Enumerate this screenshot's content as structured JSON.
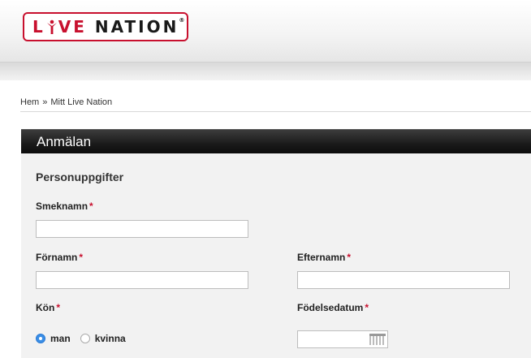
{
  "brand": {
    "logo_left": "L",
    "logo_mid": "VE",
    "logo_right": "NATION",
    "logo_full": "LIVE NATION",
    "accent_color": "#c8102e"
  },
  "breadcrumb": {
    "home": "Hem",
    "separator": "»",
    "current": "Mitt Live Nation"
  },
  "panel": {
    "title": "Anmälan",
    "section_title": "Personuppgifter"
  },
  "form": {
    "required_mark": "*",
    "nickname": {
      "label": "Smeknamn",
      "value": ""
    },
    "first_name": {
      "label": "Förnamn",
      "value": ""
    },
    "last_name": {
      "label": "Efternamn",
      "value": ""
    },
    "gender": {
      "label": "Kön",
      "options": [
        "man",
        "kvinna"
      ],
      "selected": "man"
    },
    "birth_date": {
      "label": "Födelsedatum",
      "value": "",
      "icon": "calendar-icon"
    }
  }
}
